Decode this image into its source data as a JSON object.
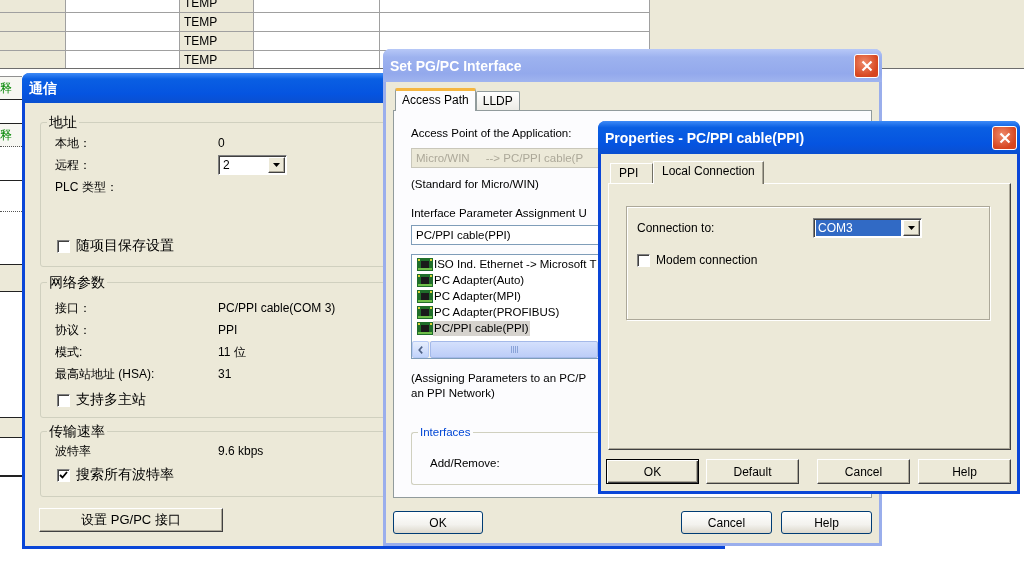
{
  "background_table": {
    "rows": [
      {
        "column_3": "TEMP"
      },
      {
        "column_3": "TEMP"
      },
      {
        "column_3": "TEMP"
      },
      {
        "column_3": "TEMP"
      }
    ]
  },
  "background_labels": [
    "释",
    "释"
  ],
  "comm_dialog": {
    "title": "通信",
    "groups": [
      {
        "title": "地址",
        "rows": [
          {
            "kind": "value",
            "label": "本地：",
            "value": "0"
          },
          {
            "kind": "dropdown",
            "label": "远程：",
            "value": "2"
          },
          {
            "kind": "value",
            "label": "PLC 类型："
          },
          {
            "kind": "checkbox",
            "label": "随项目保存设置",
            "checked": false
          }
        ]
      },
      {
        "title": "网络参数",
        "rows": [
          {
            "kind": "value",
            "label": "接口：",
            "value": "PC/PPI cable(COM 3)"
          },
          {
            "kind": "value",
            "label": "协议：",
            "value": "PPI"
          },
          {
            "kind": "value",
            "label": "模式:",
            "value": "11 位"
          },
          {
            "kind": "value",
            "label": "最高站地址 (HSA):",
            "value": "31"
          },
          {
            "kind": "checkbox",
            "label": "支持多主站",
            "checked": false
          }
        ]
      },
      {
        "title": "传输速率",
        "rows": [
          {
            "kind": "value",
            "label": "波特率",
            "value": "9.6 kbps"
          },
          {
            "kind": "checkbox",
            "label": "搜索所有波特率",
            "checked": true
          }
        ]
      }
    ],
    "button": "设置 PG/PC 接口"
  },
  "pgpc_dialog": {
    "title": "Set PG/PC Interface",
    "tabs": [
      {
        "label": "Access Path",
        "selected": true
      },
      {
        "label": "LLDP",
        "selected": false
      }
    ],
    "access_point_label": "Access Point of the Application:",
    "access_point_field": {
      "value": "Micro/WIN     --> PC/PPI cable(P",
      "disabled": true
    },
    "access_point_note": "(Standard for Micro/WIN)",
    "assignment_label": "Interface Parameter Assignment U",
    "assignment_field": "PC/PPI cable(PPI)",
    "interfaces_list": [
      {
        "label": "ISO Ind. Ethernet -> Microsoft T",
        "selected": false
      },
      {
        "label": "PC Adapter(Auto)",
        "selected": false
      },
      {
        "label": "PC Adapter(MPI)",
        "selected": false
      },
      {
        "label": "PC Adapter(PROFIBUS)",
        "selected": false
      },
      {
        "label": "PC/PPI cable(PPI)",
        "selected": true
      }
    ],
    "assignment_note": "(Assigning Parameters to an PC/P\nan PPI Network)",
    "interfaces_group": {
      "title": "Interfaces",
      "label": "Add/Remove:"
    },
    "buttons": [
      "OK",
      "Cancel",
      "Help"
    ]
  },
  "properties_dialog": {
    "title": "Properties - PC/PPI cable(PPI)",
    "tabs": [
      {
        "label": "PPI",
        "selected": false
      },
      {
        "label": "Local Connection",
        "selected": true
      }
    ],
    "connection_label": "Connection to:",
    "connection_dropdown": {
      "value": "COM3",
      "highlighted": true
    },
    "modem_checkbox": {
      "label": "Modem connection",
      "checked": false
    },
    "buttons": [
      {
        "label": "OK",
        "default": true
      },
      {
        "label": "Default",
        "default": false
      },
      {
        "label": "Cancel",
        "default": false
      },
      {
        "label": "Help",
        "default": false
      }
    ]
  }
}
